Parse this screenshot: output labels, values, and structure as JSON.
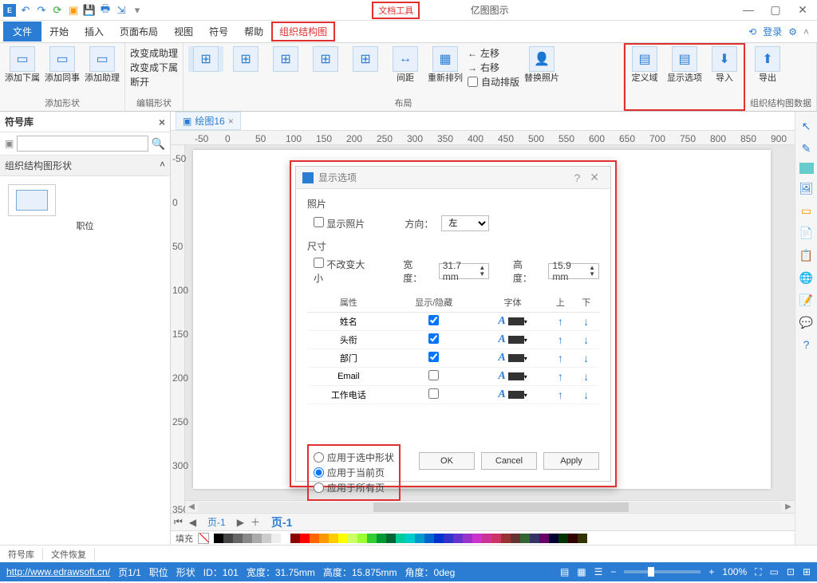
{
  "titlebar": {
    "doc_tools": "文档工具",
    "app_title": "亿图图示"
  },
  "menu": {
    "file": "文件",
    "tabs": [
      "开始",
      "插入",
      "页面布局",
      "视图",
      "符号",
      "帮助"
    ],
    "active": "组织结构图",
    "login": "登录"
  },
  "ribbon": {
    "g_add": {
      "btns": [
        "添加下属",
        "添加同事",
        "添加助理"
      ],
      "label": "添加形状"
    },
    "g_edit": {
      "lines": [
        "改变成助理",
        "改变成下属",
        "断开"
      ],
      "label": "编辑形状"
    },
    "g_layout": {
      "btns": [
        "间距",
        "重新排列"
      ],
      "move": [
        "左移",
        "右移"
      ],
      "auto": "自动排版",
      "label": "布局"
    },
    "g_photo": {
      "btn": "替换照片"
    },
    "g_data": {
      "btns": [
        "定义域",
        "显示选项",
        "导入"
      ],
      "export": "导出",
      "label": "组织结构图数据"
    }
  },
  "left": {
    "title": "符号库",
    "search_ph": "",
    "category": "组织结构图形状",
    "shape": "职位"
  },
  "doc_tab": "绘图16",
  "dialog": {
    "title": "显示选项",
    "sec_photo": "照片",
    "show_photo": "显示照片",
    "direction_lbl": "方向：",
    "direction_val": "左",
    "sec_size": "尺寸",
    "no_resize": "不改变大小",
    "width_lbl": "宽度：",
    "width_val": "31.7 mm",
    "height_lbl": "高度：",
    "height_val": "15.9 mm",
    "cols": [
      "属性",
      "显示/隐藏",
      "字体",
      "上",
      "下"
    ],
    "rows": [
      {
        "name": "姓名",
        "show": true
      },
      {
        "name": "头衔",
        "show": true
      },
      {
        "name": "部门",
        "show": true
      },
      {
        "name": "Email",
        "show": false
      },
      {
        "name": "工作电话",
        "show": false
      }
    ],
    "radios": [
      "应用于选中形状",
      "应用于当前页",
      "应用于所有页"
    ],
    "radio_sel": 1,
    "btns": {
      "ok": "OK",
      "cancel": "Cancel",
      "apply": "Apply"
    }
  },
  "bottom_tabs": [
    "符号库",
    "文件恢复"
  ],
  "page_tab": "页-1",
  "fill_lbl": "填充",
  "palette": [
    "#000000",
    "#444444",
    "#666666",
    "#888888",
    "#aaaaaa",
    "#cccccc",
    "#eeeeee",
    "#ffffff",
    "#8b0000",
    "#ff0000",
    "#ff6600",
    "#ff9900",
    "#ffcc00",
    "#ffff00",
    "#ccff66",
    "#99ff33",
    "#33cc33",
    "#009933",
    "#006633",
    "#00cc99",
    "#00cccc",
    "#0099cc",
    "#0066cc",
    "#0033cc",
    "#3333cc",
    "#6633cc",
    "#9933cc",
    "#cc33cc",
    "#cc3399",
    "#cc3366",
    "#993333",
    "#663333",
    "#336633",
    "#333366",
    "#660066",
    "#000033",
    "#003300",
    "#330000",
    "#333300"
  ],
  "status": {
    "url": "http://www.edrawsoft.cn/",
    "page": "页1/1",
    "shape": "职位",
    "shape_lbl": "形状",
    "id": "ID：101",
    "w": "宽度：31.75mm",
    "h": "高度：15.875mm",
    "ang": "角度：0deg",
    "zoom": "100%"
  },
  "ruler_h": [
    0,
    50,
    100,
    150,
    200,
    250,
    300
  ],
  "ruler_v": [
    0,
    50,
    100,
    150
  ]
}
